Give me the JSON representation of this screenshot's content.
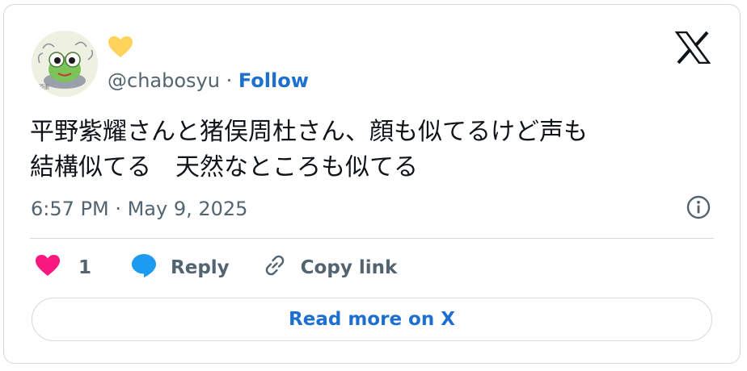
{
  "author": {
    "handle": "@chabosyu",
    "separator": "·",
    "follow_label": "Follow",
    "badge_icon": "yellow-heart-icon",
    "avatar_icon": "frog-character-avatar"
  },
  "tweet": {
    "lines": [
      "平野紫耀さんと猪俣周杜さん、顔も似てるけど声も",
      "結構似てる　天然なところも似てる"
    ],
    "timestamp": "6:57 PM · May 9, 2025"
  },
  "actions": {
    "like_count": "1",
    "reply_label": "Reply",
    "copy_link_label": "Copy link"
  },
  "read_more_label": "Read more on X",
  "colors": {
    "link_blue": "#1d6fd0",
    "like_pink": "#f91880",
    "reply_blue": "#1d9bf0",
    "heart_yellow": "#ffd25a",
    "muted_text": "#536471",
    "border": "#cfd9de"
  }
}
